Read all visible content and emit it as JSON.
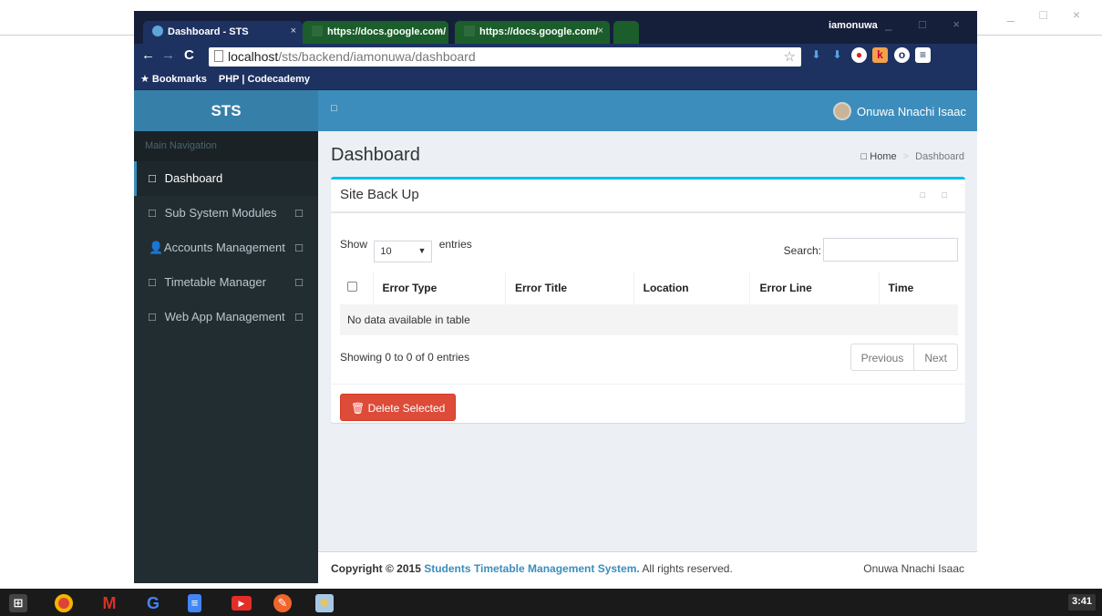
{
  "desktop": {
    "controls": "_ □ ×"
  },
  "browser": {
    "tabs": [
      {
        "title": "Dashboard - STS",
        "close": "×"
      },
      {
        "title": "https://docs.google.com/",
        "close": "×"
      },
      {
        "title": "https://docs.google.com/",
        "close": "×"
      }
    ],
    "window_user": "iamonuwa",
    "window_controls": "_ □ ×",
    "url_host": "localhost",
    "url_path": "/sts/backend/iamonuwa/dashboard",
    "star": "☆",
    "bookmarks": [
      "★ Bookmarks",
      "PHP | Codecademy"
    ]
  },
  "app": {
    "logo": "STS",
    "nav_header": "Main Navigation",
    "nav_items": [
      {
        "icon": "□",
        "label": "Dashboard",
        "caret": ""
      },
      {
        "icon": "□",
        "label": "Sub System Modules",
        "caret": "□"
      },
      {
        "icon": "👤",
        "label": "Accounts Management",
        "caret": "□"
      },
      {
        "icon": "□",
        "label": "Timetable Manager",
        "caret": "□"
      },
      {
        "icon": "□",
        "label": "Web App Management",
        "caret": "□"
      }
    ],
    "toggle_icon": "□",
    "user_name": "Onuwa Nnachi Isaac",
    "page_title": "Dashboard",
    "breadcrumb": {
      "icon": "□",
      "home": "Home",
      "sep": ">",
      "current": "Dashboard"
    },
    "box": {
      "title": "Site Back Up",
      "tools": "□ □",
      "show_label": "Show",
      "length_value": "10",
      "entries_label": "entries",
      "search_label": "Search:",
      "search_value": "",
      "columns": [
        "Error Type",
        "Error Title",
        "Location",
        "Error Line",
        "Time"
      ],
      "empty_message": "No data available in table",
      "info": "Showing 0 to 0 of 0 entries",
      "pager": {
        "prev": "Previous",
        "next": "Next"
      },
      "delete_button": "Delete Selected"
    },
    "footer": {
      "copyright_prefix": "Copyright © 2015",
      "system_name": "Students Timetable Management System.",
      "rights": "All rights reserved.",
      "right_text": "Onuwa Nnachi Isaac"
    }
  },
  "taskbar": {
    "clock": "3:41"
  }
}
